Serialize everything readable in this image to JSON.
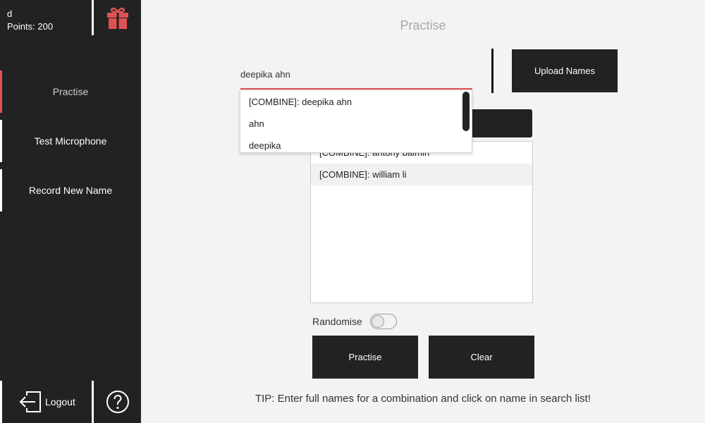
{
  "user": {
    "name": "d",
    "points_text": "Points: 200"
  },
  "nav": {
    "items": [
      {
        "label": "Practise",
        "active": true
      },
      {
        "label": "Test Microphone",
        "active": false
      },
      {
        "label": "Record New Name",
        "active": false
      }
    ],
    "logout_label": "Logout"
  },
  "icons": {
    "gift": "gift-icon",
    "logout": "logout-icon",
    "help": "help-icon"
  },
  "colors": {
    "sidebar_bg": "#222222",
    "accent": "#e05252",
    "page_bg": "#f3f3f3",
    "button_bg": "#222222"
  },
  "main": {
    "title": "Practise",
    "search_value": "deepika ahn",
    "upload_label": "Upload Names",
    "suggestions": [
      "[COMBINE]: deepika ahn",
      "ahn",
      "deepika"
    ],
    "names_list": [
      "[COMBINE]: antony balmin",
      "[COMBINE]: william li"
    ],
    "randomise_label": "Randomise",
    "randomise_on": false,
    "practise_label": "Practise",
    "clear_label": "Clear",
    "tip": "TIP: Enter full names for a combination and click on name in search list!"
  }
}
